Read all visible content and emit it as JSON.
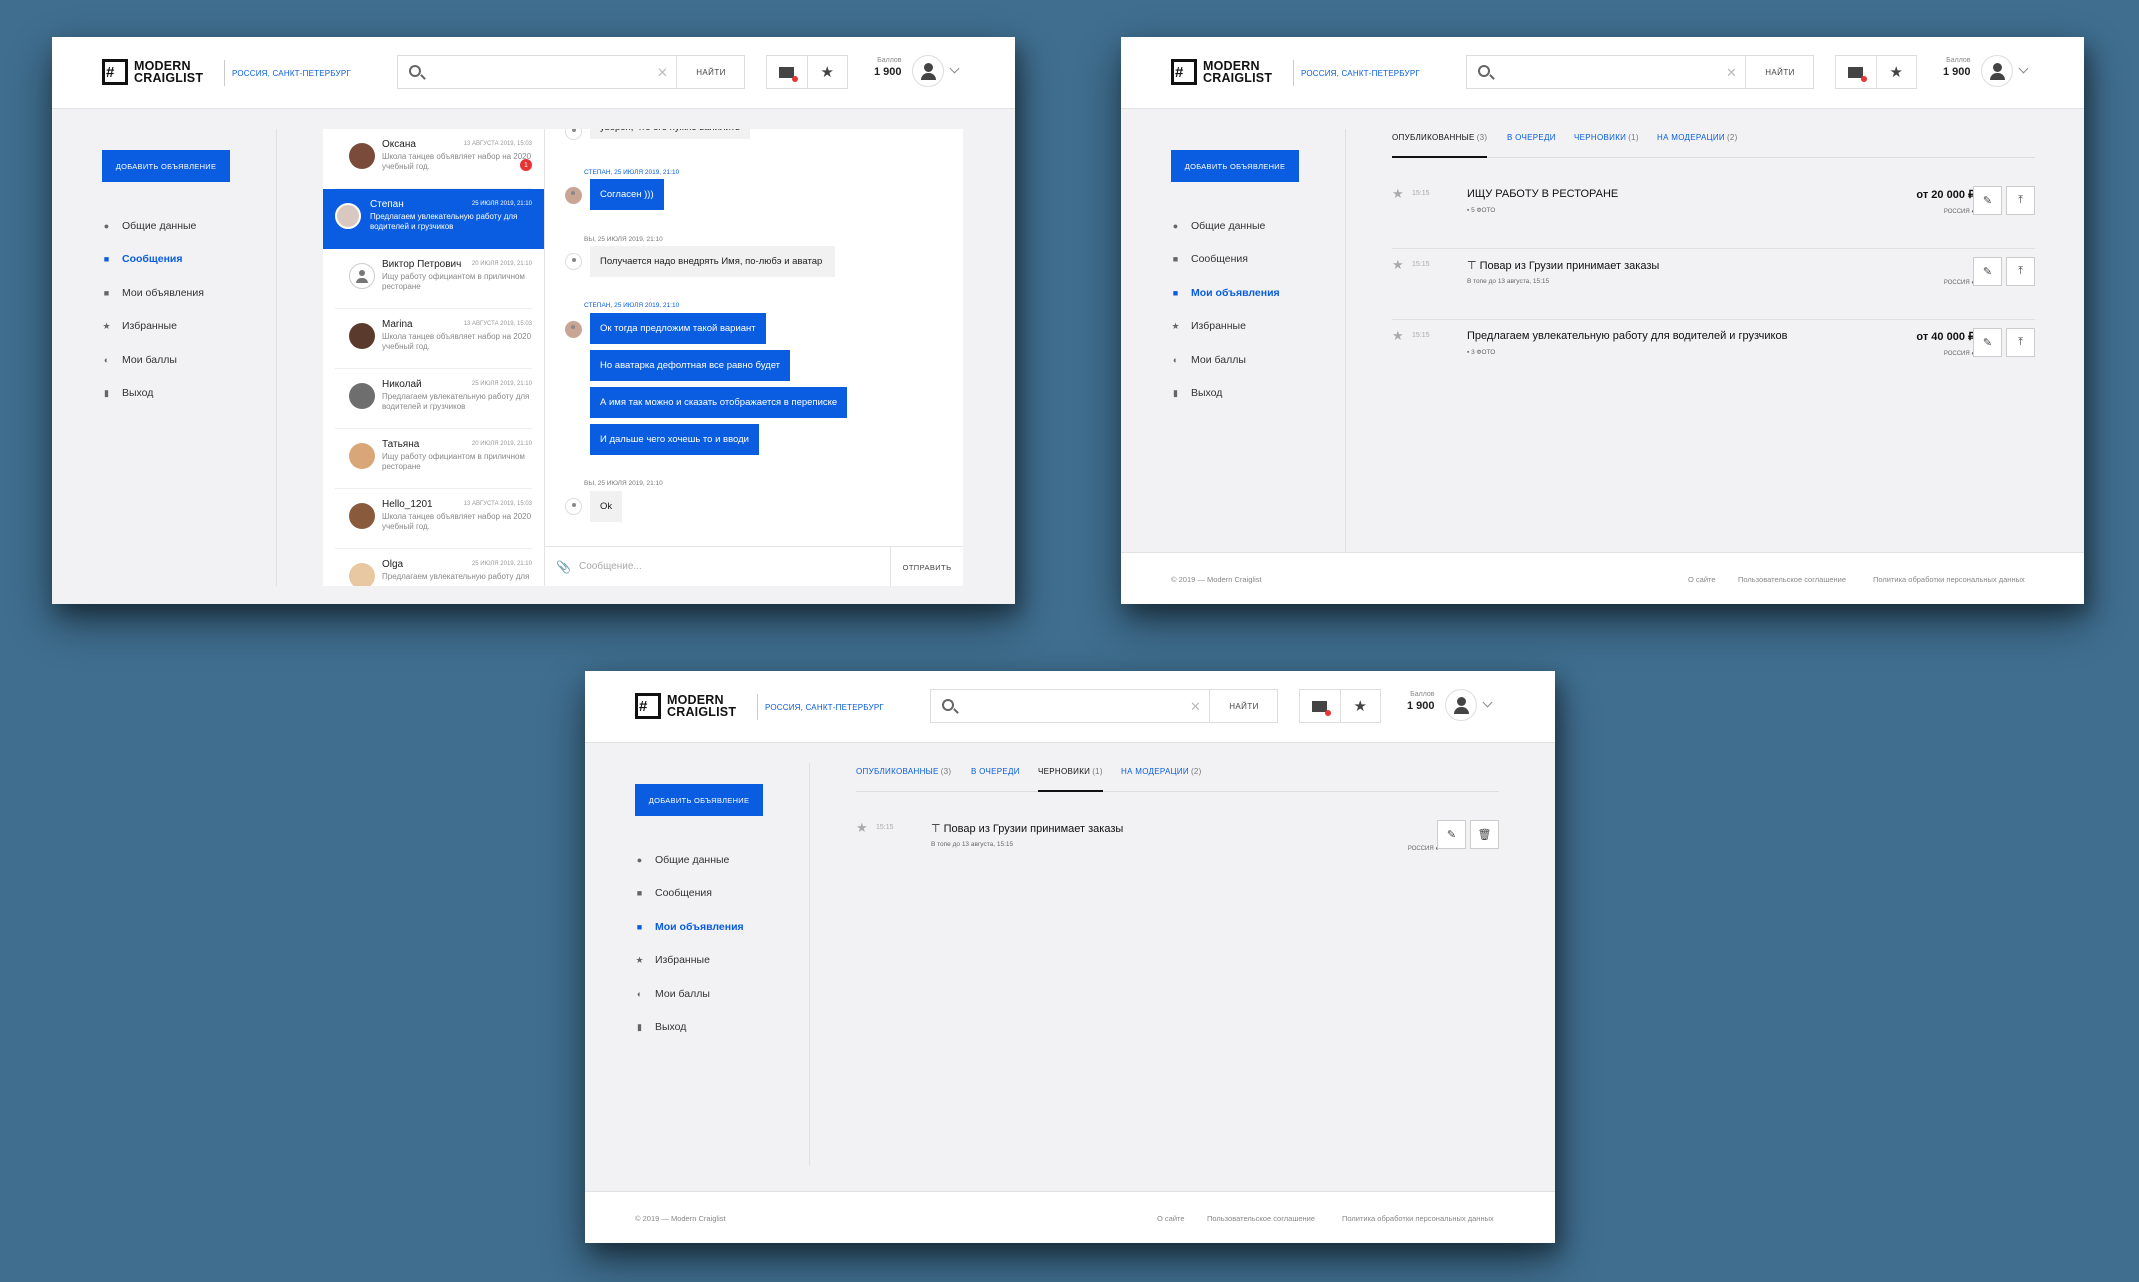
{
  "header": {
    "logo_line1": "MODERN",
    "logo_line2": "CRAIGLIST",
    "city": "РОССИЯ, САНКТ-ПЕТЕРБУРГ",
    "search_button": "НАЙТИ",
    "points_label": "Баллов",
    "points_value": "1 900"
  },
  "sidebar": {
    "add_button": "ДОБАВИТЬ ОБЪЯВЛЕНИЕ",
    "items": [
      {
        "label": "Общие данные",
        "icon": "person-icon"
      },
      {
        "label": "Сообщения",
        "icon": "messages-icon"
      },
      {
        "label": "Мои объявления",
        "icon": "document-icon"
      },
      {
        "label": "Избранные",
        "icon": "star-icon"
      },
      {
        "label": "Мои баллы",
        "icon": "toggle-icon"
      },
      {
        "label": "Выход",
        "icon": "logout-icon"
      }
    ]
  },
  "chat": {
    "contacts": [
      {
        "name": "Оксана",
        "date": "13 АВГУСТА 2019, 15:03",
        "preview": "Школа танцев объявляет набор на 2020 учебный год.",
        "badge": "1"
      },
      {
        "name": "Степан",
        "date": "25 ИЮЛЯ 2019, 21:10",
        "preview": "Предлагаем увлекательную работу для водителей и грузчиков"
      },
      {
        "name": "Виктор Петрович",
        "date": "20 ИЮЛЯ 2019, 21:10",
        "preview": "Ищу работу официантом в приличном ресторане"
      },
      {
        "name": "Marina",
        "date": "13 АВГУСТА 2019, 15:03",
        "preview": "Школа танцев объявляет набор на 2020 учебный год."
      },
      {
        "name": "Николай",
        "date": "25 ИЮЛЯ 2019, 21:10",
        "preview": "Предлагаем увлекательную работу для водителей и грузчиков"
      },
      {
        "name": "Татьяна",
        "date": "20 ИЮЛЯ 2019, 21:10",
        "preview": "Ищу работу официантом в приличном ресторане"
      },
      {
        "name": "Hello_1201",
        "date": "13 АВГУСТА 2019, 15:03",
        "preview": "Школа танцев объявляет набор на 2020 учебный год."
      },
      {
        "name": "Olga",
        "date": "25 ИЮЛЯ 2019, 21:10",
        "preview": "Предлагаем увлекательную работу для"
      }
    ],
    "messages": {
      "m0": "уверен, что его нужно вапилить",
      "h1": "СТЕПАН, 25 ИЮЛЯ 2019, 21:10",
      "m1": "Согласен )))",
      "h2": "ВЫ, 25 ИЮЛЯ 2019, 21:10",
      "m2": "Получается надо внедрять Имя, по-любэ и аватар",
      "h3": "СТЕПАН, 25 ИЮЛЯ 2019, 21:10",
      "m3": "Ок тогда предложим такой вариант",
      "m4": "Но аватарка дефолтная все равно будет",
      "m5": "А имя так можно и сказать отображается в переписке",
      "m6": "И дальше чего хочешь то и вводи",
      "h4": "ВЫ, 25 ИЮЛЯ 2019, 21:10",
      "m7": "Ok"
    },
    "input_placeholder": "Сообщение...",
    "send_button": "ОТПРАВИТЬ"
  },
  "tabs": {
    "published": "ОПУБЛИКОВАННЫЕ",
    "published_count": "(3)",
    "queue": "В ОЧЕРЕДИ",
    "drafts": "ЧЕРНОВИКИ",
    "drafts_count": "(1)",
    "moderation": "НА МОДЕРАЦИИ",
    "moderation_count": "(2)"
  },
  "published_list": [
    {
      "time": "15:15",
      "title": "ИЩУ РАБОТУ В РЕСТОРАНЕ",
      "sub": "5 ФОТО",
      "price": "от 20 000 ₽",
      "location": "РОССИЯ"
    },
    {
      "time": "15:15",
      "title": "Повар из Грузии принимает заказы",
      "sub": "В топе до 13 августа, 15:15",
      "price": "",
      "location": "РОССИЯ"
    },
    {
      "time": "15:15",
      "title": "Предлагаем увлекательную работу для водителей и грузчиков",
      "sub": "3 ФОТО",
      "price": "от 40 000 ₽",
      "location": "РОССИЯ"
    }
  ],
  "drafts_list": [
    {
      "time": "15:15",
      "title": "Повар из Грузии принимает заказы",
      "sub": "В топе до 13 августа, 15:15",
      "location": "РОССИЯ"
    }
  ],
  "footer": {
    "copyright": "© 2019 — Modern Craiglist",
    "about": "О сайте",
    "terms": "Пользовательское соглашение",
    "privacy": "Политика обработки персональных данных"
  },
  "colors": {
    "accent": "#0a5de0",
    "background": "#3f6e8f",
    "badge": "#e63333"
  }
}
